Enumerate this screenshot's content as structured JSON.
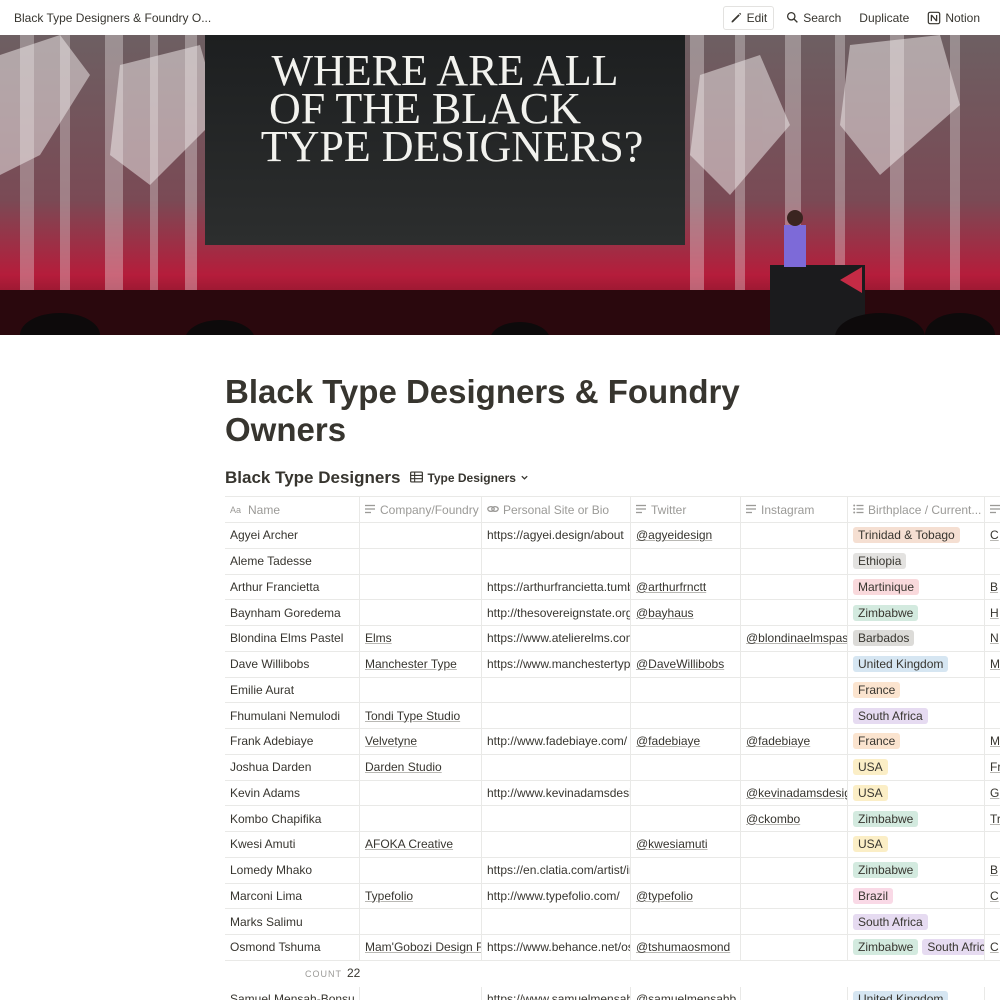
{
  "topbar": {
    "page_title": "Black Type Designers & Foundry O...",
    "edit_label": "Edit",
    "search_label": "Search",
    "duplicate_label": "Duplicate",
    "notion_label": "Notion"
  },
  "cover": {
    "slide_line1": "WHERE ARE ALL",
    "slide_line2": "OF THE BLACK",
    "slide_line3": "TYPE DESIGNERS?"
  },
  "page_title": "Black Type Designers & Foundry Owners",
  "database": {
    "title": "Black Type Designers",
    "view_name": "Type Designers",
    "columns": [
      "Name",
      "Company/Foundry",
      "Personal Site or Bio",
      "Twitter",
      "Instagram",
      "Birthplace / Current..."
    ],
    "rows": [
      {
        "name": "Agyei Archer",
        "company": "",
        "site": "https://agyei.design/about",
        "twitter": "@agyeidesign",
        "instagram": "",
        "places": [
          {
            "label": "Trinidad & Tobago",
            "color": "#f5dfd2"
          }
        ],
        "extra": "C"
      },
      {
        "name": "Aleme Tadesse",
        "company": "",
        "site": "",
        "twitter": "",
        "instagram": "",
        "places": [
          {
            "label": "Ethiopia",
            "color": "#e3e2e0"
          }
        ],
        "extra": ""
      },
      {
        "name": "Arthur Francietta",
        "company": "",
        "site": "https://arthurfrancietta.tumblr.com",
        "twitter": "@arthurfrnctt",
        "instagram": "",
        "places": [
          {
            "label": "Martinique",
            "color": "#f9d9dc"
          }
        ],
        "extra": "B"
      },
      {
        "name": "Baynham Goredema",
        "company": "",
        "site": "http://thesovereignstate.org/",
        "twitter": "@bayhaus",
        "instagram": "",
        "places": [
          {
            "label": "Zimbabwe",
            "color": "#d3eadf"
          }
        ],
        "extra": "H"
      },
      {
        "name": "Blondina Elms Pastel",
        "company": "Elms",
        "site": "https://www.atelierelms.com/p",
        "twitter": "",
        "instagram": "@blondinaelmspastel",
        "places": [
          {
            "label": "Barbados",
            "color": "#dcdbd8"
          }
        ],
        "extra": "N"
      },
      {
        "name": "Dave Willibobs",
        "company": "Manchester Type",
        "site": "https://www.manchestertype.com",
        "twitter": "@DaveWillibobs",
        "instagram": "",
        "places": [
          {
            "label": "United Kingdom",
            "color": "#d6e6f2"
          }
        ],
        "extra": "M"
      },
      {
        "name": "Emilie Aurat",
        "company": "",
        "site": "",
        "twitter": "",
        "instagram": "",
        "places": [
          {
            "label": "France",
            "color": "#fbe4cf"
          }
        ],
        "extra": ""
      },
      {
        "name": "Fhumulani Nemulodi",
        "company": "Tondi Type Studio",
        "site": "",
        "twitter": "",
        "instagram": "",
        "places": [
          {
            "label": "South Africa",
            "color": "#e6dbf1"
          }
        ],
        "extra": ""
      },
      {
        "name": "Frank Adebiaye",
        "company": "Velvetyne",
        "site": "http://www.fadebiaye.com/",
        "twitter": "@fadebiaye",
        "instagram": "@fadebiaye",
        "places": [
          {
            "label": "France",
            "color": "#fbe4cf"
          }
        ],
        "extra": "M"
      },
      {
        "name": "Joshua Darden",
        "company": "Darden Studio",
        "site": "",
        "twitter": "",
        "instagram": "",
        "places": [
          {
            "label": "USA",
            "color": "#fbeec6"
          }
        ],
        "extra": "Fr"
      },
      {
        "name": "Kevin Adams",
        "company": "",
        "site": "http://www.kevinadamsdesign.com",
        "twitter": "",
        "instagram": "@kevinadamsdesign",
        "places": [
          {
            "label": "USA",
            "color": "#fbeec6"
          }
        ],
        "extra": "G"
      },
      {
        "name": "Kombo Chapifika",
        "company": "",
        "site": "",
        "twitter": "",
        "instagram": "@ckombo",
        "places": [
          {
            "label": "Zimbabwe",
            "color": "#d3eadf"
          }
        ],
        "extra": "Tr"
      },
      {
        "name": "Kwesi Amuti",
        "company": "AFOKA Creative",
        "site": "",
        "twitter": "@kwesiamuti",
        "instagram": "",
        "places": [
          {
            "label": "USA",
            "color": "#fbeec6"
          }
        ],
        "extra": ""
      },
      {
        "name": "Lomedy Mhako",
        "company": "",
        "site": "https://en.clatia.com/artist/ind",
        "twitter": "",
        "instagram": "",
        "places": [
          {
            "label": "Zimbabwe",
            "color": "#d3eadf"
          }
        ],
        "extra": "B"
      },
      {
        "name": "Marconi Lima",
        "company": "Typefolio",
        "site": "http://www.typefolio.com/",
        "twitter": "@typefolio",
        "instagram": "",
        "places": [
          {
            "label": "Brazil",
            "color": "#f9d9e6"
          }
        ],
        "extra": "C"
      },
      {
        "name": "Marks Salimu",
        "company": "",
        "site": "",
        "twitter": "",
        "instagram": "",
        "places": [
          {
            "label": "South Africa",
            "color": "#e6dbf1"
          }
        ],
        "extra": ""
      },
      {
        "name": "Osmond Tshuma",
        "company": "Mam'Gobozi Design Factory",
        "site": "https://www.behance.net/osm",
        "twitter": "@tshumaosmond",
        "instagram": "",
        "places": [
          {
            "label": "Zimbabwe",
            "color": "#d3eadf"
          },
          {
            "label": "South Africa",
            "color": "#e6dbf1"
          }
        ],
        "extra": "C"
      }
    ],
    "count_label": "COUNT",
    "count_value": "22",
    "overflow_row": {
      "name": "Samuel Mensah-Bonsu",
      "company": "",
      "site": "https://www.samuelmensah.c",
      "twitter": "@samuelmensahb",
      "instagram": "",
      "places": [
        {
          "label": "United Kingdom",
          "color": "#d6e6f2"
        }
      ],
      "extra": ""
    }
  }
}
